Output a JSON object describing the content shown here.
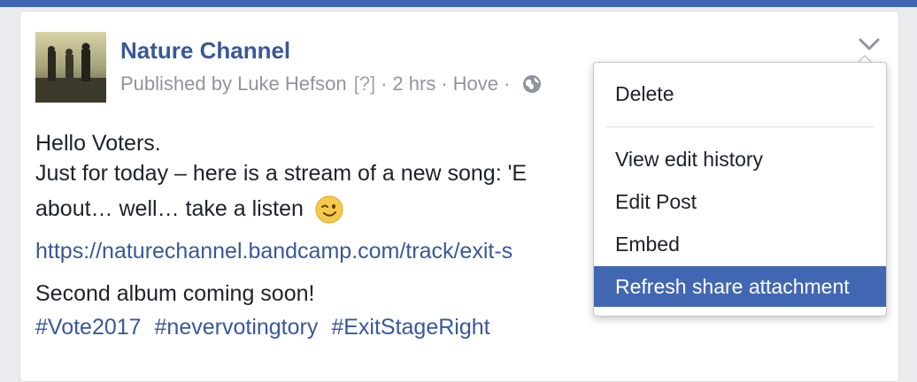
{
  "post": {
    "page_name": "Nature Channel",
    "published_by": "Published by Luke Hefson",
    "help_marker": "[?]",
    "time": "2 hrs",
    "location": "Hove",
    "separator": "·",
    "body_line1": "Hello Voters.",
    "body_line2": "Just for today – here is a stream of a new song: 'E",
    "body_line3": "about… well… take a listen",
    "link": "https://naturechannel.bandcamp.com/track/exit-s",
    "closing_line": "Second album coming soon!",
    "hashtags": [
      "#Vote2017",
      "#nevervotingtory",
      "#ExitStageRight"
    ]
  },
  "menu": {
    "items": [
      {
        "label": "Delete"
      },
      {
        "label": "View edit history"
      },
      {
        "label": "Edit Post"
      },
      {
        "label": "Embed"
      },
      {
        "label": "Refresh share attachment"
      }
    ],
    "active_index": 4
  },
  "colors": {
    "brand_blue": "#4267b2",
    "link_blue": "#385898",
    "meta_gray": "#90949c",
    "text": "#1d2129"
  },
  "icons": [
    "globe-icon",
    "chevron-down-icon",
    "wink-emoji-icon"
  ]
}
